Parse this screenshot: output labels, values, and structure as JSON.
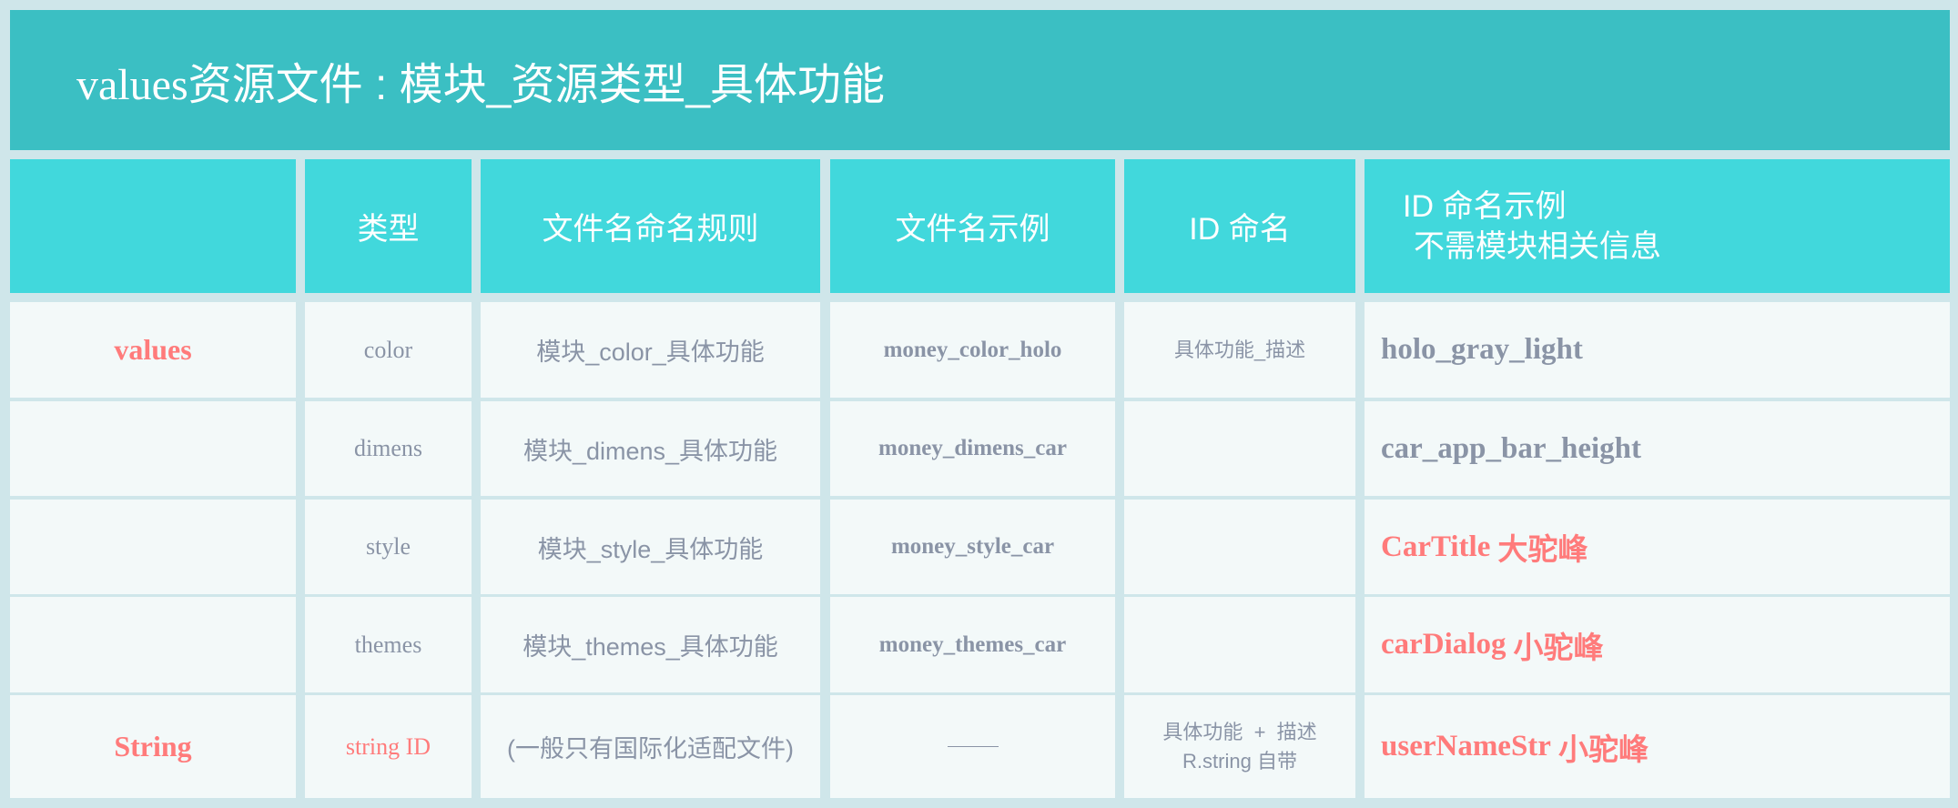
{
  "title": {
    "latin": "values",
    "rest": "资源文件 : 模块_资源类型_具体功能"
  },
  "header": {
    "category": "",
    "type": "类型",
    "file_rule": "文件名命名规则",
    "file_example": "文件名示例",
    "id_naming": "ID 命名",
    "id_example_line1": "ID 命名示例",
    "id_example_line2": "不需模块相关信息"
  },
  "rows": [
    {
      "category": "values",
      "type": "color",
      "file_rule": "模块_color_具体功能",
      "file_example": "money_color_holo",
      "id_naming": "具体功能_描述",
      "id_naming_line2": "",
      "id_example": "holo_gray_light",
      "id_example_note": "",
      "highlight": false
    },
    {
      "category": "",
      "type": "dimens",
      "file_rule": "模块_dimens_具体功能",
      "file_example": "money_dimens_car",
      "id_naming": "",
      "id_naming_line2": "",
      "id_example": "car_app_bar_height",
      "id_example_note": "",
      "highlight": false
    },
    {
      "category": "",
      "type": "style",
      "file_rule": "模块_style_具体功能",
      "file_example": "money_style_car",
      "id_naming": "",
      "id_naming_line2": "",
      "id_example": "CarTitle",
      "id_example_note": "大驼峰",
      "highlight": true
    },
    {
      "category": "",
      "type": "themes",
      "file_rule": "模块_themes_具体功能",
      "file_example": "money_themes_car",
      "id_naming": "",
      "id_naming_line2": "",
      "id_example": "carDialog",
      "id_example_note": "小驼峰",
      "highlight": true
    },
    {
      "category": "String",
      "type": "string ID",
      "file_rule": "(一般只有国际化适配文件)",
      "file_example": "——",
      "id_naming": "具体功能  +  描述",
      "id_naming_line2": "R.string 自带",
      "id_example": "userNameStr",
      "id_example_note": "小驼峰",
      "highlight": true
    }
  ],
  "colors": {
    "title_band": "#3bbfc3",
    "header_cell": "#41d8dc",
    "body_cell": "#f3f9f9",
    "grid": "#cfe6ea",
    "accent_pink": "#ff7b7b",
    "text_gray": "#8a94a6"
  }
}
